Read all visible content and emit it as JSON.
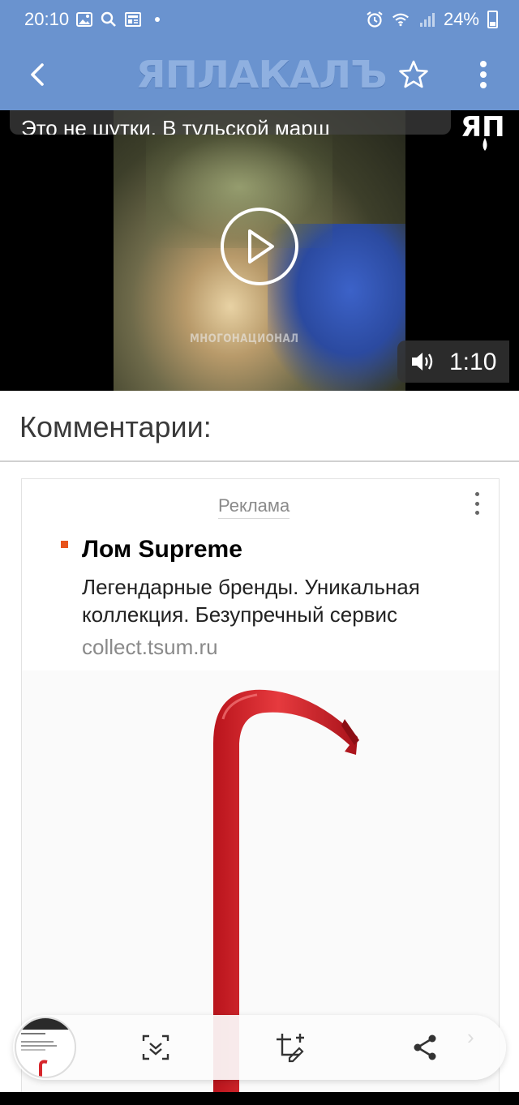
{
  "status_bar": {
    "time": "20:10",
    "battery": "24%",
    "icons_left": [
      "gallery-icon",
      "search-icon",
      "news-icon",
      "dot"
    ],
    "icons_right": [
      "alarm-icon",
      "wifi-icon",
      "signal-icon",
      "battery-icon"
    ]
  },
  "app_bar": {
    "logo_text": "ЯПЛАКАЛЪ",
    "color": "#6a93cf"
  },
  "video": {
    "title": "Это не шутки. В тульской марш",
    "watermark": "МНОГОНАЦИОНАЛ",
    "duration": "1:10",
    "corner_logo": "ЯП"
  },
  "comments": {
    "heading": "Комментарии:"
  },
  "ad": {
    "label": "Реклама",
    "title": "Лом Supreme",
    "description": "Легендарные бренды. Уникальная коллекция. Безупречный сервис",
    "url": "collect.tsum.ru",
    "marker_color": "#e8531b",
    "product_color": "#d7262c"
  },
  "screenshot_toolbar": {
    "buttons": [
      "scroll-capture-icon",
      "crop-edit-icon",
      "share-icon"
    ]
  }
}
